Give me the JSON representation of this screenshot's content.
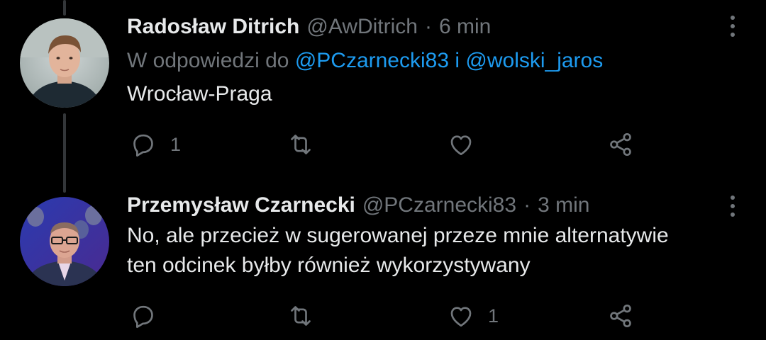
{
  "tweets": [
    {
      "name": "Radosław Ditrich",
      "handle": "@AwDitrich",
      "separator": "·",
      "time": "6 min",
      "reply_to": {
        "prefix": "W odpowiedzi do",
        "mention1": "@PCzarnecki83",
        "joiner": "i",
        "mention2": "@wolski_jaros"
      },
      "text_lines": [
        "Wrocław-Praga"
      ],
      "actions": {
        "reply": "1",
        "retweet": "",
        "like": ""
      },
      "avatar_icon": "profile-photo-young-man"
    },
    {
      "name": "Przemysław Czarnecki",
      "handle": "@PCzarnecki83",
      "separator": "·",
      "time": "3 min",
      "text_lines": [
        "No, ale przecież w sugerowanej przeze mnie alternatywie",
        "ten odcinek byłby również wykorzystywany"
      ],
      "actions": {
        "reply": "",
        "retweet": "",
        "like": "1"
      },
      "avatar_icon": "profile-photo-man-glasses"
    }
  ],
  "colors": {
    "background": "#000000",
    "text": "#e7e9ea",
    "muted": "#71767b",
    "link": "#1d9bf0",
    "thread": "#333639"
  }
}
